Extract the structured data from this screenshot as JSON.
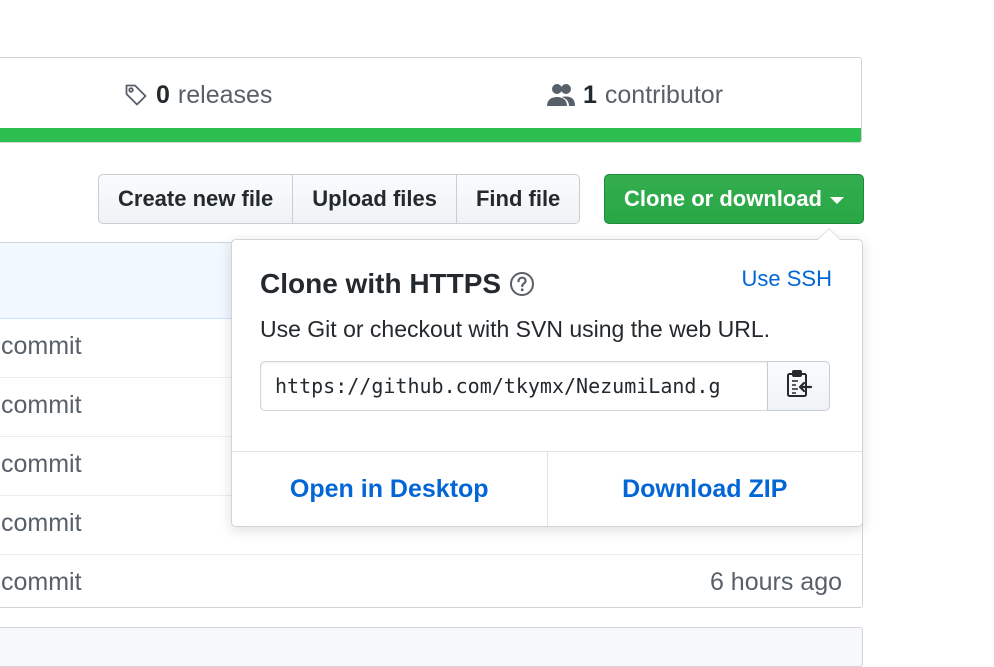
{
  "summary": {
    "releases_count": "0",
    "releases_label": "releases",
    "contributors_count": "1",
    "contributors_label": "contributor",
    "language_color": "#2cbe4e"
  },
  "toolbar": {
    "create_label": "Create new file",
    "upload_label": "Upload files",
    "find_label": "Find file",
    "clone_label": "Clone or download",
    "clone_color": "#28a745"
  },
  "files": [
    {
      "message": "commit",
      "age": ""
    },
    {
      "message": "commit",
      "age": ""
    },
    {
      "message": "commit",
      "age": ""
    },
    {
      "message": "commit",
      "age": ""
    },
    {
      "message": "commit",
      "age": "6 hours ago"
    }
  ],
  "clone_popup": {
    "title": "Clone with HTTPS",
    "switch_label": "Use SSH",
    "description": "Use Git or checkout with SVN using the web URL.",
    "url": "https://github.com/tkymx/NezumiLand.g",
    "open_desktop_label": "Open in Desktop",
    "download_zip_label": "Download ZIP",
    "link_color": "#0366d6"
  },
  "icons": {
    "releases": "tag-icon",
    "contributors": "people-icon",
    "help": "question-icon",
    "copy": "clipboard-icon"
  }
}
